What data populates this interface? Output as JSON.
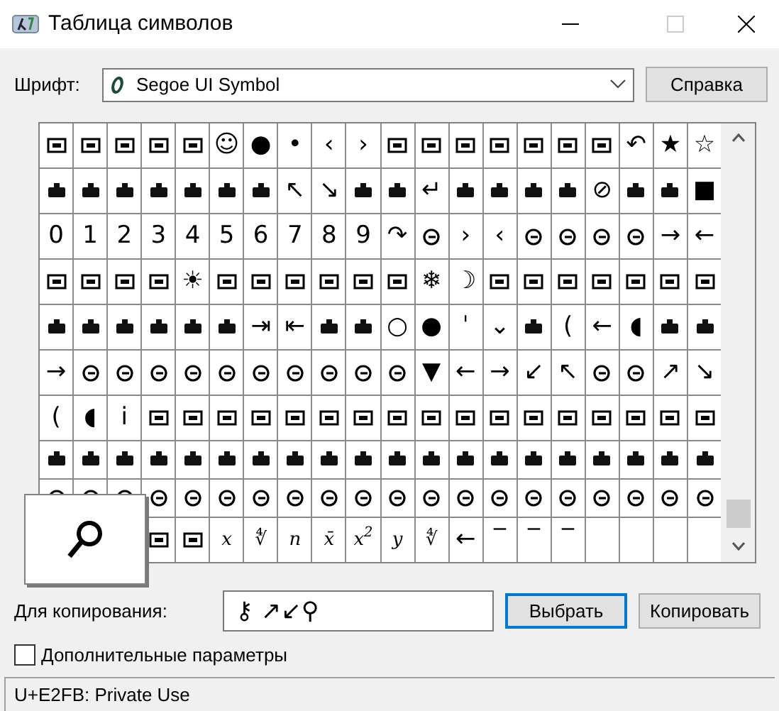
{
  "window": {
    "title": "Таблица символов"
  },
  "font": {
    "label": "Шрифт:",
    "value": "Segoe UI Symbol"
  },
  "help_button": "Справка",
  "grid": [
    [
      {
        "kind": "icon"
      },
      {
        "kind": "icon"
      },
      {
        "kind": "icon"
      },
      {
        "kind": "icon"
      },
      {
        "kind": "icon"
      },
      {
        "kind": "char",
        "text": "☺"
      },
      {
        "kind": "char",
        "text": "●"
      },
      {
        "kind": "char",
        "text": "•"
      },
      {
        "kind": "char",
        "text": "‹"
      },
      {
        "kind": "char",
        "text": "›"
      },
      {
        "kind": "icon"
      },
      {
        "kind": "icon"
      },
      {
        "kind": "icon"
      },
      {
        "kind": "icon"
      },
      {
        "kind": "icon"
      },
      {
        "kind": "icon"
      },
      {
        "kind": "icon"
      },
      {
        "kind": "char",
        "text": "↶"
      },
      {
        "kind": "char",
        "text": "★"
      },
      {
        "kind": "char",
        "text": "☆"
      }
    ],
    [
      {
        "kind": "icon"
      },
      {
        "kind": "icon"
      },
      {
        "kind": "icon"
      },
      {
        "kind": "icon"
      },
      {
        "kind": "icon"
      },
      {
        "kind": "icon"
      },
      {
        "kind": "icon"
      },
      {
        "kind": "char",
        "text": "↖"
      },
      {
        "kind": "char",
        "text": "↘"
      },
      {
        "kind": "icon"
      },
      {
        "kind": "icon"
      },
      {
        "kind": "char",
        "text": "↵"
      },
      {
        "kind": "icon"
      },
      {
        "kind": "icon"
      },
      {
        "kind": "icon"
      },
      {
        "kind": "icon"
      },
      {
        "kind": "char",
        "text": "⊘"
      },
      {
        "kind": "icon"
      },
      {
        "kind": "icon"
      },
      {
        "kind": "char",
        "text": "■"
      }
    ],
    [
      {
        "kind": "char",
        "text": "0"
      },
      {
        "kind": "char",
        "text": "1"
      },
      {
        "kind": "char",
        "text": "2"
      },
      {
        "kind": "char",
        "text": "3"
      },
      {
        "kind": "char",
        "text": "4"
      },
      {
        "kind": "char",
        "text": "5"
      },
      {
        "kind": "char",
        "text": "6"
      },
      {
        "kind": "char",
        "text": "7"
      },
      {
        "kind": "char",
        "text": "8"
      },
      {
        "kind": "char",
        "text": "9"
      },
      {
        "kind": "char",
        "text": "↷"
      },
      {
        "kind": "icon"
      },
      {
        "kind": "char",
        "text": "›"
      },
      {
        "kind": "char",
        "text": "‹"
      },
      {
        "kind": "icon"
      },
      {
        "kind": "icon"
      },
      {
        "kind": "icon"
      },
      {
        "kind": "icon"
      },
      {
        "kind": "char",
        "text": "→"
      },
      {
        "kind": "char",
        "text": "←"
      }
    ],
    [
      {
        "kind": "icon"
      },
      {
        "kind": "icon"
      },
      {
        "kind": "icon"
      },
      {
        "kind": "icon"
      },
      {
        "kind": "char",
        "text": "☀"
      },
      {
        "kind": "icon"
      },
      {
        "kind": "icon"
      },
      {
        "kind": "icon"
      },
      {
        "kind": "icon"
      },
      {
        "kind": "icon"
      },
      {
        "kind": "icon"
      },
      {
        "kind": "char",
        "text": "❄"
      },
      {
        "kind": "char",
        "text": "☽"
      },
      {
        "kind": "icon"
      },
      {
        "kind": "icon"
      },
      {
        "kind": "icon"
      },
      {
        "kind": "icon"
      },
      {
        "kind": "icon"
      },
      {
        "kind": "icon"
      },
      {
        "kind": "icon"
      }
    ],
    [
      {
        "kind": "icon"
      },
      {
        "kind": "icon"
      },
      {
        "kind": "icon"
      },
      {
        "kind": "icon"
      },
      {
        "kind": "icon"
      },
      {
        "kind": "icon"
      },
      {
        "kind": "char",
        "text": "⇥"
      },
      {
        "kind": "char",
        "text": "⇤"
      },
      {
        "kind": "icon"
      },
      {
        "kind": "icon"
      },
      {
        "kind": "char",
        "text": "○"
      },
      {
        "kind": "char",
        "text": "●"
      },
      {
        "kind": "char",
        "text": "ˈ"
      },
      {
        "kind": "char",
        "text": "⌄"
      },
      {
        "kind": "icon"
      },
      {
        "kind": "char",
        "text": "("
      },
      {
        "kind": "char",
        "text": "←"
      },
      {
        "kind": "char",
        "text": "◖"
      },
      {
        "kind": "icon"
      },
      {
        "kind": "icon"
      }
    ],
    [
      {
        "kind": "char",
        "text": "→"
      },
      {
        "kind": "icon"
      },
      {
        "kind": "icon"
      },
      {
        "kind": "icon"
      },
      {
        "kind": "icon"
      },
      {
        "kind": "icon"
      },
      {
        "kind": "icon"
      },
      {
        "kind": "icon"
      },
      {
        "kind": "icon"
      },
      {
        "kind": "icon"
      },
      {
        "kind": "icon"
      },
      {
        "kind": "char",
        "text": "▼"
      },
      {
        "kind": "char",
        "text": "←"
      },
      {
        "kind": "char",
        "text": "→"
      },
      {
        "kind": "char",
        "text": "↙"
      },
      {
        "kind": "char",
        "text": "↖"
      },
      {
        "kind": "icon"
      },
      {
        "kind": "icon"
      },
      {
        "kind": "char",
        "text": "↗"
      },
      {
        "kind": "char",
        "text": "↘"
      }
    ],
    [
      {
        "kind": "char",
        "text": "("
      },
      {
        "kind": "char",
        "text": "◖"
      },
      {
        "kind": "char",
        "text": "i"
      },
      {
        "kind": "icon"
      },
      {
        "kind": "icon"
      },
      {
        "kind": "icon"
      },
      {
        "kind": "icon"
      },
      {
        "kind": "icon"
      },
      {
        "kind": "icon"
      },
      {
        "kind": "icon"
      },
      {
        "kind": "icon"
      },
      {
        "kind": "icon"
      },
      {
        "kind": "icon"
      },
      {
        "kind": "icon"
      },
      {
        "kind": "icon"
      },
      {
        "kind": "icon"
      },
      {
        "kind": "icon"
      },
      {
        "kind": "icon"
      },
      {
        "kind": "icon"
      },
      {
        "kind": "icon"
      }
    ],
    [
      {
        "kind": "icon"
      },
      {
        "kind": "icon"
      },
      {
        "kind": "icon"
      },
      {
        "kind": "icon"
      },
      {
        "kind": "icon"
      },
      {
        "kind": "icon"
      },
      {
        "kind": "icon"
      },
      {
        "kind": "icon"
      },
      {
        "kind": "icon"
      },
      {
        "kind": "icon"
      },
      {
        "kind": "icon"
      },
      {
        "kind": "icon"
      },
      {
        "kind": "icon"
      },
      {
        "kind": "icon"
      },
      {
        "kind": "icon"
      },
      {
        "kind": "icon"
      },
      {
        "kind": "icon"
      },
      {
        "kind": "icon"
      },
      {
        "kind": "icon"
      },
      {
        "kind": "icon"
      }
    ],
    [
      {
        "kind": "icon"
      },
      {
        "kind": "icon"
      },
      {
        "kind": "icon"
      },
      {
        "kind": "icon"
      },
      {
        "kind": "icon"
      },
      {
        "kind": "icon"
      },
      {
        "kind": "icon"
      },
      {
        "kind": "icon"
      },
      {
        "kind": "icon"
      },
      {
        "kind": "icon"
      },
      {
        "kind": "icon"
      },
      {
        "kind": "icon"
      },
      {
        "kind": "icon"
      },
      {
        "kind": "icon"
      },
      {
        "kind": "icon"
      },
      {
        "kind": "icon"
      },
      {
        "kind": "icon"
      },
      {
        "kind": "icon"
      },
      {
        "kind": "icon"
      },
      {
        "kind": "icon"
      }
    ],
    [
      {
        "kind": "icon"
      },
      {
        "kind": "icon"
      },
      {
        "kind": "math",
        "text": "x"
      },
      {
        "kind": "math",
        "text": "∜"
      },
      {
        "kind": "math",
        "text": "n"
      },
      {
        "kind": "math",
        "text": "x̄"
      },
      {
        "kind": "math",
        "text": "x$^{2}$"
      },
      {
        "kind": "math",
        "text": "y"
      },
      {
        "kind": "math",
        "text": "∜"
      },
      {
        "kind": "char",
        "text": "←"
      },
      {
        "kind": "char",
        "text": "‾"
      },
      {
        "kind": "char",
        "text": "‾"
      },
      {
        "kind": "char",
        "text": "‾"
      },
      {
        "kind": "empty"
      },
      {
        "kind": "empty"
      },
      {
        "kind": "empty"
      },
      {
        "kind": "empty"
      }
    ]
  ],
  "copy": {
    "label": "Для копирования:",
    "value": "⚷ ↗↙⚲"
  },
  "select_button": {
    "label": "Выбрать",
    "focused": true
  },
  "copy_button": {
    "label": "Копировать",
    "focused": false
  },
  "advanced": {
    "label": "Дополнительные параметры",
    "checked": false
  },
  "status_bar": "U+E2FB: Private Use"
}
